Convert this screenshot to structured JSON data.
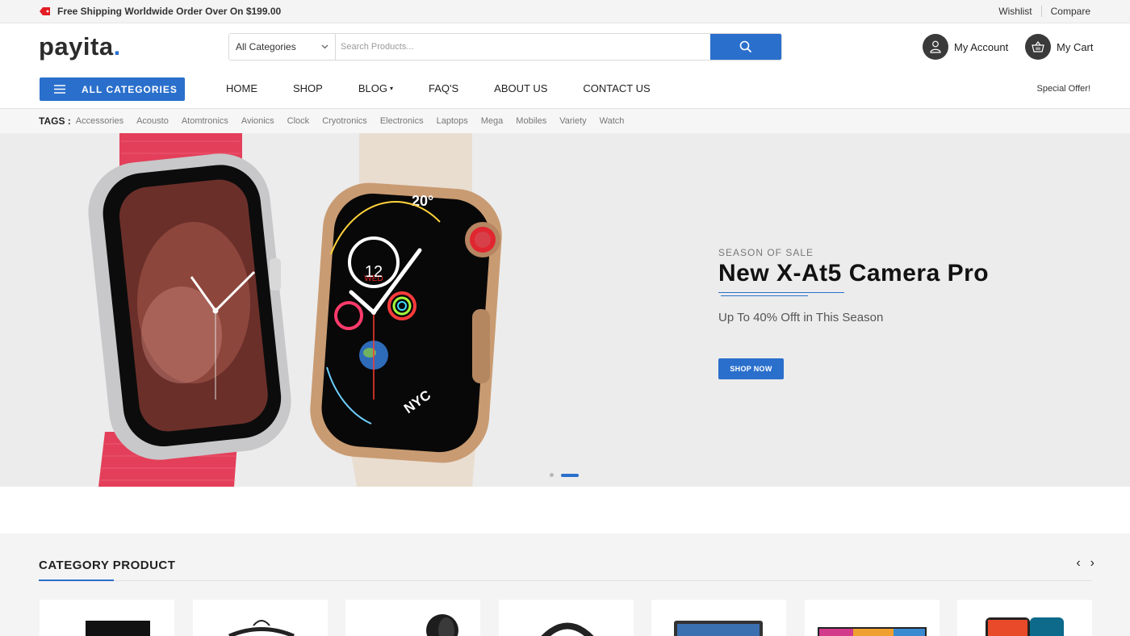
{
  "topbar": {
    "shipping": "Free Shipping Worldwide Order Over On $199.00",
    "wishlist": "Wishlist",
    "compare": "Compare"
  },
  "header": {
    "logo": "payita",
    "logo_dot": ".",
    "category_select": "All Categories",
    "search_placeholder": "Search Products...",
    "account": "My Account",
    "cart": "My Cart"
  },
  "nav": {
    "all_categories": "ALL CATEGORIES",
    "items": [
      "HOME",
      "SHOP",
      "BLOG",
      "FAQ'S",
      "ABOUT US",
      "CONTACT US"
    ],
    "special": "Special Offer!"
  },
  "tags": {
    "label": "TAGS :",
    "items": [
      "Accessories",
      "Acousto",
      "Atomtronics",
      "Avionics",
      "Clock",
      "Cryotronics",
      "Electronics",
      "Laptops",
      "Mega",
      "Mobiles",
      "Variety",
      "Watch"
    ]
  },
  "hero": {
    "eyebrow": "SEASON OF SALE",
    "title": "New X-At5 Camera Pro",
    "subtitle": "Up To 40% Offt in This Season",
    "button": "SHOP NOW",
    "watch_face_day": "WED",
    "watch_face_date": "12",
    "watch_temp": "20°",
    "watch_city": "NYC"
  },
  "category_section": {
    "title": "CATEGORY PRODUCT",
    "prev": "‹",
    "next": "›"
  },
  "colors": {
    "accent": "#2a6fcc",
    "dark": "#222222",
    "hero_bg": "#ececec"
  }
}
